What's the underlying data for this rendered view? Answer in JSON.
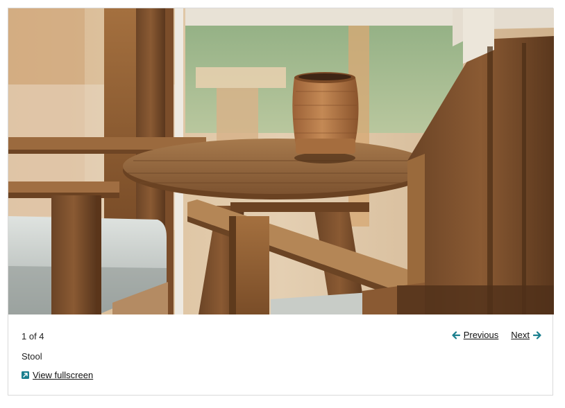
{
  "gallery": {
    "image_alt": "Wooden chairs around a round wooden table with a woven container",
    "counter": "1 of 4",
    "caption": "Stool",
    "fullscreen_label": "View fullscreen",
    "previous_label": "Previous",
    "next_label": "Next"
  },
  "colors": {
    "accent": "#1a7f8e",
    "text": "#222222",
    "border": "#d9d9d9"
  },
  "icons": {
    "previous": "arrow-left-icon",
    "next": "arrow-right-icon",
    "fullscreen": "external-link-icon"
  }
}
